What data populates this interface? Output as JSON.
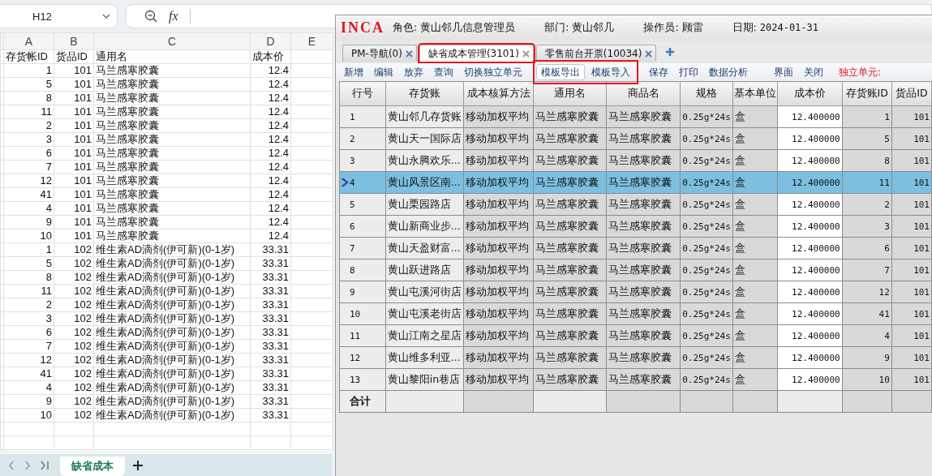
{
  "spreadsheet": {
    "name_box": "H12",
    "function_label": "fx",
    "column_letters": [
      "A",
      "B",
      "C",
      "D",
      "E"
    ],
    "columns": [
      "存货帐ID",
      "货品ID",
      "通用名",
      "成本价"
    ],
    "rows": [
      [
        "1",
        "101",
        "马兰感寒胶囊",
        "12.4"
      ],
      [
        "5",
        "101",
        "马兰感寒胶囊",
        "12.4"
      ],
      [
        "8",
        "101",
        "马兰感寒胶囊",
        "12.4"
      ],
      [
        "11",
        "101",
        "马兰感寒胶囊",
        "12.4"
      ],
      [
        "2",
        "101",
        "马兰感寒胶囊",
        "12.4"
      ],
      [
        "3",
        "101",
        "马兰感寒胶囊",
        "12.4"
      ],
      [
        "6",
        "101",
        "马兰感寒胶囊",
        "12.4"
      ],
      [
        "7",
        "101",
        "马兰感寒胶囊",
        "12.4"
      ],
      [
        "12",
        "101",
        "马兰感寒胶囊",
        "12.4"
      ],
      [
        "41",
        "101",
        "马兰感寒胶囊",
        "12.4"
      ],
      [
        "4",
        "101",
        "马兰感寒胶囊",
        "12.4"
      ],
      [
        "9",
        "101",
        "马兰感寒胶囊",
        "12.4"
      ],
      [
        "10",
        "101",
        "马兰感寒胶囊",
        "12.4"
      ],
      [
        "1",
        "102",
        "维生素AD滴剂(伊可新)(0-1岁)",
        "33.31"
      ],
      [
        "5",
        "102",
        "维生素AD滴剂(伊可新)(0-1岁)",
        "33.31"
      ],
      [
        "8",
        "102",
        "维生素AD滴剂(伊可新)(0-1岁)",
        "33.31"
      ],
      [
        "11",
        "102",
        "维生素AD滴剂(伊可新)(0-1岁)",
        "33.31"
      ],
      [
        "2",
        "102",
        "维生素AD滴剂(伊可新)(0-1岁)",
        "33.31"
      ],
      [
        "3",
        "102",
        "维生素AD滴剂(伊可新)(0-1岁)",
        "33.31"
      ],
      [
        "6",
        "102",
        "维生素AD滴剂(伊可新)(0-1岁)",
        "33.31"
      ],
      [
        "7",
        "102",
        "维生素AD滴剂(伊可新)(0-1岁)",
        "33.31"
      ],
      [
        "12",
        "102",
        "维生素AD滴剂(伊可新)(0-1岁)",
        "33.31"
      ],
      [
        "41",
        "102",
        "维生素AD滴剂(伊可新)(0-1岁)",
        "33.31"
      ],
      [
        "4",
        "102",
        "维生素AD滴剂(伊可新)(0-1岁)",
        "33.31"
      ],
      [
        "9",
        "102",
        "维生素AD滴剂(伊可新)(0-1岁)",
        "33.31"
      ],
      [
        "10",
        "102",
        "维生素AD滴剂(伊可新)(0-1岁)",
        "33.31"
      ]
    ],
    "sheet_tabs": [
      {
        "label": "缺省成本",
        "selected": true
      }
    ]
  },
  "app": {
    "logo": "INCA",
    "info": [
      {
        "label": "角色:",
        "value": "黄山邻几信息管理员"
      },
      {
        "label": "部门:",
        "value": "黄山邻几"
      },
      {
        "label": "操作员:",
        "value": "顾雷"
      },
      {
        "label": "日期:",
        "value": "2024-01-31"
      }
    ],
    "tabs": [
      {
        "label": "PM-导航(0)",
        "selected": false,
        "highlighted": false
      },
      {
        "label": "缺省成本管理(3101)",
        "selected": true,
        "highlighted": true
      },
      {
        "label": "零售前台开票(10034)",
        "selected": false,
        "highlighted": false
      }
    ],
    "toolbar": [
      {
        "label": "新增",
        "active": false,
        "highlighted": false
      },
      {
        "label": "编辑",
        "active": false,
        "highlighted": false
      },
      {
        "label": "放弃",
        "active": false,
        "highlighted": false
      },
      {
        "label": "查询",
        "active": false,
        "highlighted": false
      },
      {
        "label": "切换独立单元",
        "active": false,
        "highlighted": false
      },
      {
        "label": "模板导出",
        "active": true,
        "highlighted": true
      },
      {
        "label": "模板导入",
        "active": false,
        "highlighted": true
      },
      {
        "label": "保存",
        "active": false,
        "highlighted": false
      },
      {
        "label": "打印",
        "active": false,
        "highlighted": false
      },
      {
        "label": "数据分析",
        "active": false,
        "highlighted": false
      },
      {
        "label": "界面",
        "active": false,
        "highlighted": false
      },
      {
        "label": "关闭",
        "active": false,
        "highlighted": false
      }
    ],
    "unit_label": "独立单元:",
    "table": {
      "columns": [
        "行号",
        "存货账",
        "成本核算方法",
        "通用名",
        "商品名",
        "规格",
        "基本单位",
        "成本价",
        "存货账ID",
        "货品ID"
      ],
      "rows": [
        {
          "cells": [
            "1",
            "黄山邻几存货账",
            "移动加权平均",
            "马兰感寒胶囊",
            "马兰感寒胶囊",
            "0.25g*24s",
            "盒",
            "12.400000",
            "1",
            "101"
          ],
          "selected": false
        },
        {
          "cells": [
            "2",
            "黄山天一国际店",
            "移动加权平均",
            "马兰感寒胶囊",
            "马兰感寒胶囊",
            "0.25g*24s",
            "盒",
            "12.400000",
            "5",
            "101"
          ],
          "selected": false
        },
        {
          "cells": [
            "3",
            "黄山永腾欢乐...",
            "移动加权平均",
            "马兰感寒胶囊",
            "马兰感寒胶囊",
            "0.25g*24s",
            "盒",
            "12.400000",
            "8",
            "101"
          ],
          "selected": false
        },
        {
          "cells": [
            "4",
            "黄山风景区南...",
            "移动加权平均",
            "马兰感寒胶囊",
            "马兰感寒胶囊",
            "0.25g*24s",
            "盒",
            "12.400000",
            "11",
            "101"
          ],
          "selected": true
        },
        {
          "cells": [
            "5",
            "黄山栗园路店",
            "移动加权平均",
            "马兰感寒胶囊",
            "马兰感寒胶囊",
            "0.25g*24s",
            "盒",
            "12.400000",
            "2",
            "101"
          ],
          "selected": false
        },
        {
          "cells": [
            "6",
            "黄山新商业步...",
            "移动加权平均",
            "马兰感寒胶囊",
            "马兰感寒胶囊",
            "0.25g*24s",
            "盒",
            "12.400000",
            "3",
            "101"
          ],
          "selected": false
        },
        {
          "cells": [
            "7",
            "黄山天盈财富...",
            "移动加权平均",
            "马兰感寒胶囊",
            "马兰感寒胶囊",
            "0.25g*24s",
            "盒",
            "12.400000",
            "6",
            "101"
          ],
          "selected": false
        },
        {
          "cells": [
            "8",
            "黄山跃进路店",
            "移动加权平均",
            "马兰感寒胶囊",
            "马兰感寒胶囊",
            "0.25g*24s",
            "盒",
            "12.400000",
            "7",
            "101"
          ],
          "selected": false
        },
        {
          "cells": [
            "9",
            "黄山屯溪河街店",
            "移动加权平均",
            "马兰感寒胶囊",
            "马兰感寒胶囊",
            "0.25g*24s",
            "盒",
            "12.400000",
            "12",
            "101"
          ],
          "selected": false
        },
        {
          "cells": [
            "10",
            "黄山屯溪老街店",
            "移动加权平均",
            "马兰感寒胶囊",
            "马兰感寒胶囊",
            "0.25g*24s",
            "盒",
            "12.400000",
            "41",
            "101"
          ],
          "selected": false
        },
        {
          "cells": [
            "11",
            "黄山江南之星店",
            "移动加权平均",
            "马兰感寒胶囊",
            "马兰感寒胶囊",
            "0.25g*24s",
            "盒",
            "12.400000",
            "4",
            "101"
          ],
          "selected": false
        },
        {
          "cells": [
            "12",
            "黄山维多利亚...",
            "移动加权平均",
            "马兰感寒胶囊",
            "马兰感寒胶囊",
            "0.25g*24s",
            "盒",
            "12.400000",
            "9",
            "101"
          ],
          "selected": false
        },
        {
          "cells": [
            "13",
            "黄山黎阳in巷店",
            "移动加权平均",
            "马兰感寒胶囊",
            "马兰感寒胶囊",
            "0.25g*24s",
            "盒",
            "12.400000",
            "10",
            "101"
          ],
          "selected": false
        }
      ],
      "footer": "合计"
    }
  }
}
